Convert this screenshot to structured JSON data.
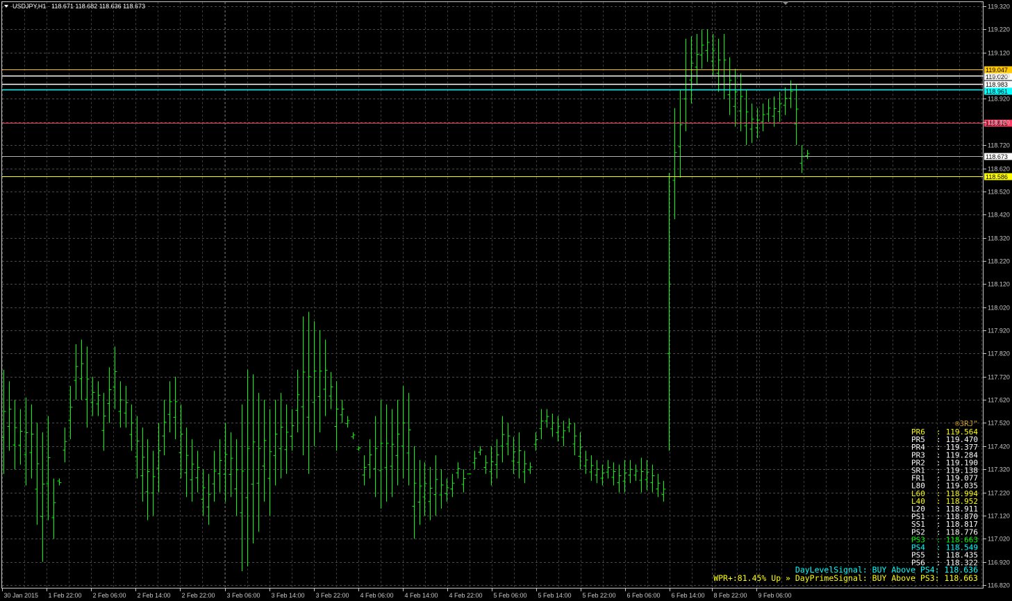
{
  "window": {
    "symbol_label": "USDJPY,H1",
    "ohlc_label": "118.671 118.682 118.636 118.673",
    "colors": {
      "background": "#000000",
      "grid": "#4a4a4a",
      "bars": "#00ff00",
      "axis_text": "#c8c8c8"
    }
  },
  "chart_data": {
    "type": "bar",
    "subtype": "ohlc",
    "ylim": [
      116.82,
      119.33
    ],
    "grid": true,
    "price_ticks": [
      "119.320",
      "119.220",
      "119.120",
      "119.020",
      "118.920",
      "118.820",
      "118.720",
      "118.620",
      "118.520",
      "118.420",
      "118.320",
      "118.220",
      "118.120",
      "118.020",
      "117.920",
      "117.820",
      "117.720",
      "117.620",
      "117.520",
      "117.420",
      "117.320",
      "117.220",
      "117.120",
      "117.020",
      "116.920",
      "116.820"
    ],
    "time_ticks": [
      "30 Jan 2015",
      "1 Feb 22:00",
      "2 Feb 06:00",
      "2 Feb 14:00",
      "2 Feb 22:00",
      "3 Feb 06:00",
      "3 Feb 14:00",
      "3 Feb 22:00",
      "4 Feb 06:00",
      "4 Feb 14:00",
      "4 Feb 22:00",
      "5 Feb 06:00",
      "5 Feb 14:00",
      "5 Feb 22:00",
      "6 Feb 06:00",
      "6 Feb 14:00",
      "8 Feb 22:00",
      "9 Feb 06:00"
    ],
    "bars_high": [
      117.75,
      117.7,
      117.62,
      117.58,
      117.63,
      117.6,
      117.52,
      117.48,
      117.55,
      117.28,
      117.25,
      117.5,
      117.68,
      117.86,
      117.88,
      117.85,
      117.72,
      117.7,
      117.65,
      117.76,
      117.85,
      117.7,
      117.68,
      117.6,
      117.55,
      117.5,
      117.45,
      117.4,
      117.52,
      117.62,
      117.7,
      117.72,
      117.6,
      117.5,
      117.45,
      117.4,
      117.32,
      117.3,
      117.4,
      117.45,
      117.52,
      117.48,
      117.45,
      117.6,
      117.75,
      117.73,
      117.65,
      117.62,
      117.58,
      117.62,
      117.65,
      117.6,
      117.58,
      117.75,
      117.98,
      118.0,
      117.96,
      117.92,
      117.88,
      117.74,
      117.7,
      117.62,
      117.55,
      117.48,
      117.42,
      117.38,
      117.45,
      117.55,
      117.62,
      117.6,
      117.58,
      117.62,
      117.68,
      117.65,
      117.42,
      117.36,
      117.35,
      117.33,
      117.38,
      117.32,
      117.28,
      117.3,
      117.35,
      117.32,
      117.3,
      117.4,
      117.42,
      117.38,
      117.42,
      117.45,
      117.55,
      117.52,
      117.46,
      117.48,
      117.4,
      117.35,
      117.48,
      117.58,
      117.58,
      117.56,
      117.55,
      117.53,
      117.54,
      117.52,
      117.48,
      117.4,
      117.38,
      117.36,
      117.34,
      117.36,
      117.35,
      117.34,
      117.36,
      117.36,
      117.34,
      117.37,
      117.36,
      117.34,
      117.3,
      117.27,
      118.6,
      118.88,
      118.96,
      119.18,
      119.19,
      119.2,
      119.22,
      119.22,
      119.2,
      119.18,
      119.2,
      119.1,
      119.05,
      119.03,
      118.96,
      118.9,
      118.88,
      118.9,
      118.92,
      118.93,
      118.95,
      118.97,
      119.0,
      118.98,
      118.72,
      118.7
    ],
    "bars_low": [
      117.3,
      117.4,
      117.32,
      117.34,
      117.25,
      117.28,
      117.08,
      116.92,
      117.1,
      117.02,
      117.28,
      117.35,
      117.45,
      117.62,
      117.62,
      117.5,
      117.55,
      117.55,
      117.4,
      117.52,
      117.58,
      117.5,
      117.5,
      117.4,
      117.28,
      117.18,
      117.1,
      117.12,
      117.22,
      117.38,
      117.48,
      117.45,
      117.28,
      117.2,
      117.18,
      117.22,
      117.12,
      117.08,
      117.18,
      117.22,
      117.18,
      117.2,
      117.12,
      116.88,
      116.9,
      117.0,
      117.05,
      117.18,
      117.12,
      117.25,
      117.28,
      117.3,
      117.4,
      117.48,
      117.38,
      117.3,
      117.42,
      117.48,
      117.55,
      117.58,
      117.4,
      117.52,
      117.5,
      117.45,
      117.4,
      117.25,
      117.28,
      117.2,
      117.15,
      117.18,
      117.2,
      117.25,
      117.28,
      117.25,
      117.02,
      117.08,
      117.12,
      117.1,
      117.12,
      117.15,
      117.18,
      117.2,
      117.28,
      117.22,
      117.3,
      117.32,
      117.38,
      117.3,
      117.25,
      117.28,
      117.35,
      117.38,
      117.3,
      117.28,
      117.26,
      117.3,
      117.4,
      117.45,
      117.5,
      117.46,
      117.44,
      117.42,
      117.48,
      117.38,
      117.32,
      117.3,
      117.27,
      117.26,
      117.25,
      117.28,
      117.25,
      117.22,
      117.22,
      117.26,
      117.27,
      117.22,
      117.23,
      117.22,
      117.2,
      117.18,
      117.4,
      118.4,
      118.58,
      118.78,
      118.9,
      118.98,
      119.05,
      119.08,
      119.02,
      118.95,
      118.92,
      118.85,
      118.8,
      118.78,
      118.72,
      118.73,
      118.75,
      118.78,
      118.82,
      118.8,
      118.82,
      118.85,
      118.88,
      118.72,
      118.6,
      118.66
    ],
    "hlines": [
      {
        "price": "119.047",
        "color": "#ffc800",
        "label_bg": "#ffc800",
        "label_fg": "#000000"
      },
      {
        "price": "119.020",
        "color": "#ffffff",
        "label_bg": "#ffffff",
        "label_fg": "#000000"
      },
      {
        "price": "118.983",
        "color": "#ffffff",
        "label_bg": "#ffffff",
        "label_fg": "#000000"
      },
      {
        "price": "118.961",
        "color": "#00ffff",
        "label_bg": "#00ffff",
        "label_fg": "#000000"
      },
      {
        "price": "118.816",
        "color": "#ff3c64",
        "label_bg": "#ff3c64",
        "label_fg": "#000000"
      },
      {
        "price": "118.673",
        "color": "#b4b4b4",
        "label_bg": "#ffffff",
        "label_fg": "#000000"
      },
      {
        "price": "118.586",
        "color": "#ffff00",
        "label_bg": "#ffff00",
        "label_fg": "#000000"
      }
    ]
  },
  "indicator": {
    "signature": "®3RJ\"",
    "signature_color": "#d2a028",
    "levels": [
      {
        "name": "PR6",
        "value": "119.564",
        "color": "#ffff00"
      },
      {
        "name": "PR5",
        "value": "119.470",
        "color": "#ffffff"
      },
      {
        "name": "PR4",
        "value": "119.377",
        "color": "#ffffff"
      },
      {
        "name": "PR3",
        "value": "119.284",
        "color": "#ffffff"
      },
      {
        "name": "PR2",
        "value": "119.190",
        "color": "#ffffff"
      },
      {
        "name": "SR1",
        "value": "119.138",
        "color": "#ffffff"
      },
      {
        "name": "FR1",
        "value": "119.077",
        "color": "#ffffff"
      },
      {
        "name": "L80",
        "value": "119.035",
        "color": "#ffffff"
      },
      {
        "name": "L60",
        "value": "118.994",
        "color": "#ffff00"
      },
      {
        "name": "L40",
        "value": "118.952",
        "color": "#ffff00"
      },
      {
        "name": "L20",
        "value": "118.911",
        "color": "#ffffff"
      },
      {
        "name": "PS1",
        "value": "118.870",
        "color": "#ffffff"
      },
      {
        "name": "SS1",
        "value": "118.817",
        "color": "#ffffff"
      },
      {
        "name": "PS2",
        "value": "118.776",
        "color": "#ffffff"
      },
      {
        "name": "PS3",
        "value": "118.663",
        "color": "#00ff00"
      },
      {
        "name": "PS4",
        "value": "118.549",
        "color": "#00ffff"
      },
      {
        "name": "PS5",
        "value": "118.435",
        "color": "#ffffff"
      },
      {
        "name": "PS6",
        "value": "118.322",
        "color": "#ffffff"
      }
    ],
    "signal1": {
      "text": "DayLevelSignal: BUY Above PS4: 118.636",
      "color": "#00ffff"
    },
    "signal2": {
      "text": "WPR+:81.45% Up » DayPrimeSignal: BUY Above PS3: 118.663",
      "color": "#ffff00"
    }
  }
}
